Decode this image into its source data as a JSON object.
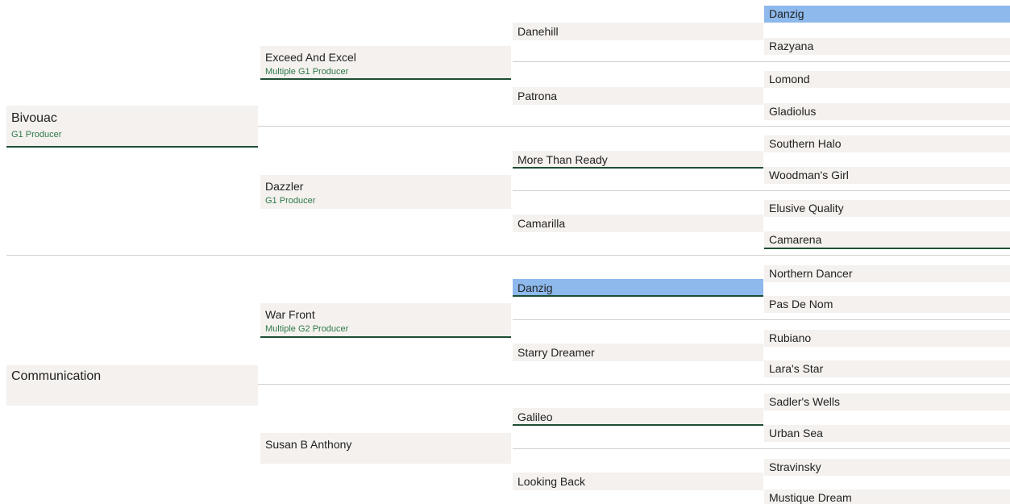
{
  "pedigree": {
    "sire": {
      "name": "Bivouac",
      "honor": "G1 Producer"
    },
    "dam": {
      "name": "Communication",
      "honor": ""
    },
    "sire_sire": {
      "name": "Exceed And Excel",
      "honor": "Multiple G1 Producer"
    },
    "sire_dam": {
      "name": "Dazzler",
      "honor": "G1 Producer"
    },
    "dam_sire": {
      "name": "War Front",
      "honor": "Multiple G2 Producer"
    },
    "dam_dam": {
      "name": "Susan B Anthony",
      "honor": ""
    },
    "gen3": [
      {
        "name": "Danehill"
      },
      {
        "name": "Patrona"
      },
      {
        "name": "More Than Ready"
      },
      {
        "name": "Camarilla"
      },
      {
        "name": "Danzig"
      },
      {
        "name": "Starry Dreamer"
      },
      {
        "name": "Galileo"
      },
      {
        "name": "Looking Back"
      }
    ],
    "gen4": [
      {
        "name": "Danzig"
      },
      {
        "name": "Razyana"
      },
      {
        "name": "Lomond"
      },
      {
        "name": "Gladiolus"
      },
      {
        "name": "Southern Halo"
      },
      {
        "name": "Woodman's Girl"
      },
      {
        "name": "Elusive Quality"
      },
      {
        "name": "Camarena"
      },
      {
        "name": "Northern Dancer"
      },
      {
        "name": "Pas De Nom"
      },
      {
        "name": "Rubiano"
      },
      {
        "name": "Lara's Star"
      },
      {
        "name": "Sadler's Wells"
      },
      {
        "name": "Urban Sea"
      },
      {
        "name": "Stravinsky"
      },
      {
        "name": "Mustique Dream"
      }
    ]
  },
  "colors": {
    "box": "#f4f1ee",
    "highlight": "#8db9ec",
    "underline": "#1e4d33",
    "honor_text": "#2f7a4a"
  }
}
